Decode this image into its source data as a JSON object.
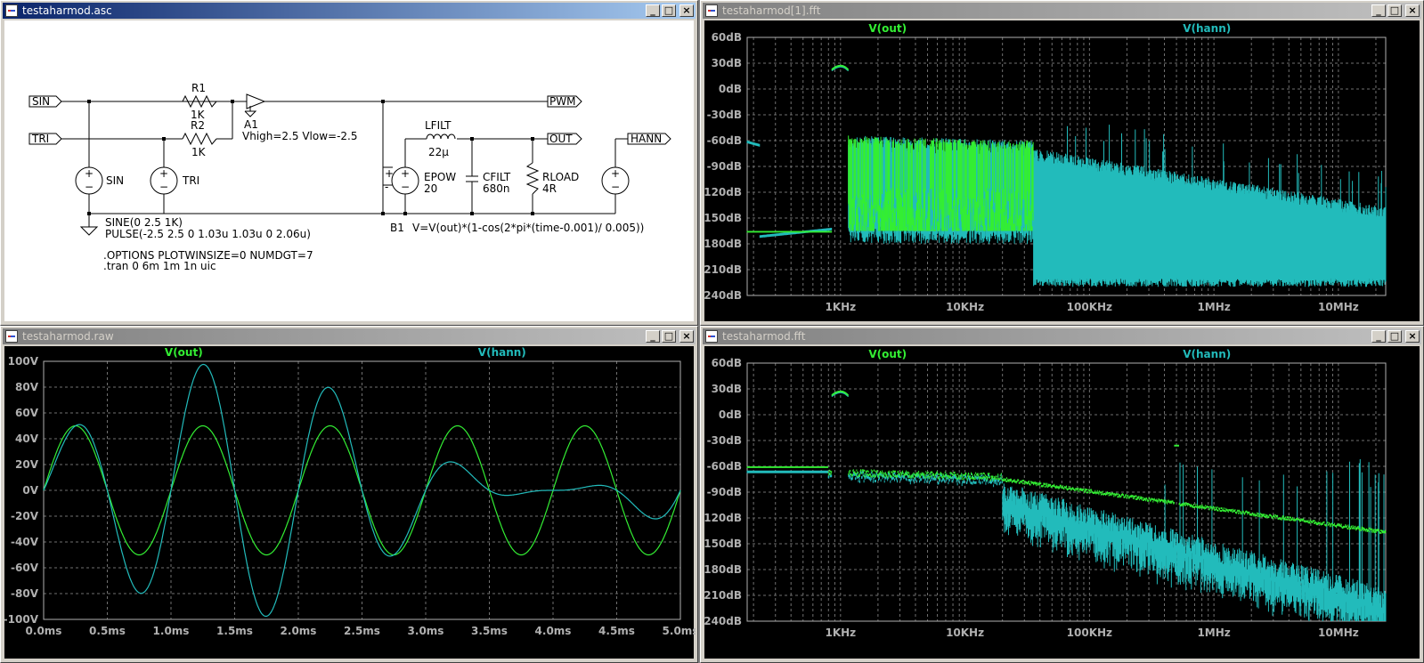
{
  "windows": {
    "schematic": {
      "title": "testaharmod.asc"
    },
    "fft1": {
      "title": "testaharmod[1].fft"
    },
    "raw": {
      "title": "testaharmod.raw"
    },
    "fft2": {
      "title": "testaharmod.fft"
    }
  },
  "buttons": {
    "minimize": "_",
    "maximize": "□",
    "close": "×"
  },
  "schematic": {
    "labels": {
      "sin": "SIN",
      "tri": "TRI",
      "pwm": "PWM",
      "out": "OUT",
      "hann": "HANN"
    },
    "r1": {
      "name": "R1",
      "value": "1K"
    },
    "r2": {
      "name": "R2",
      "value": "1K"
    },
    "a1": {
      "name": "A1",
      "params": "Vhigh=2.5 Vlow=-2.5"
    },
    "sin_source": {
      "name": "SIN"
    },
    "tri_source": {
      "name": "TRI"
    },
    "lfilt": {
      "name": "LFILT",
      "value": "22µ"
    },
    "cfilt": {
      "name": "CFILT",
      "value": "680n"
    },
    "rload": {
      "name": "RLOAD",
      "value": "4R"
    },
    "epow": {
      "name": "EPOW",
      "value": "20"
    },
    "b1": {
      "name": "B1",
      "expr": "V=V(out)*(1-cos(2*pi*(time-0.001)/ 0.005))"
    },
    "directives": {
      "sine": "SINE(0 2.5 1K)",
      "pulse": "PULSE(-2.5 2.5 0 1.03u 1.03u 0 2.06u)",
      "options": ".OPTIONS PLOTWINSIZE=0 NUMDGT=7",
      "tran": ".tran 0 6m 1m 1n uic"
    }
  },
  "colors": {
    "out": "#33ee33",
    "hann": "#22bbbb",
    "grid": "#707070",
    "axis": "#b0b0b0"
  },
  "chart_data": [
    {
      "type": "line",
      "window": "testaharmod[1].fft",
      "series": [
        {
          "name": "V(out)"
        },
        {
          "name": "V(hann)"
        }
      ],
      "yticks": [
        "60dB",
        "30dB",
        "0dB",
        "-30dB",
        "-60dB",
        "-90dB",
        "-120dB",
        "-150dB",
        "-180dB",
        "-210dB",
        "-240dB"
      ],
      "xticks": [
        "1KHz",
        "10KHz",
        "100KHz",
        "1MHz",
        "10MHz"
      ],
      "ylim": [
        -240,
        60
      ],
      "xscale": "log"
    },
    {
      "type": "line",
      "window": "testaharmod.raw",
      "series": [
        {
          "name": "V(out)",
          "amplitude": 50,
          "freq_khz": 1
        },
        {
          "name": "V(hann)",
          "peaks": [
            3,
            -22,
            50,
            -80,
            98,
            -98,
            80,
            -50,
            22,
            -3
          ]
        }
      ],
      "yticks": [
        "100V",
        "80V",
        "60V",
        "40V",
        "20V",
        "0V",
        "-20V",
        "-40V",
        "-60V",
        "-80V",
        "-100V"
      ],
      "xticks": [
        "0.0ms",
        "0.5ms",
        "1.0ms",
        "1.5ms",
        "2.0ms",
        "2.5ms",
        "3.0ms",
        "3.5ms",
        "4.0ms",
        "4.5ms",
        "5.0ms"
      ],
      "ylim": [
        -100,
        100
      ],
      "xlim": [
        0,
        5
      ]
    },
    {
      "type": "line",
      "window": "testaharmod.fft",
      "series": [
        {
          "name": "V(out)"
        },
        {
          "name": "V(hann)"
        }
      ],
      "yticks": [
        "60dB",
        "30dB",
        "0dB",
        "-30dB",
        "-60dB",
        "-90dB",
        "-120dB",
        "-150dB",
        "-180dB",
        "-210dB",
        "-240dB"
      ],
      "xticks": [
        "1KHz",
        "10KHz",
        "100KHz",
        "1MHz",
        "10MHz"
      ],
      "ylim": [
        -240,
        60
      ],
      "xscale": "log"
    }
  ]
}
